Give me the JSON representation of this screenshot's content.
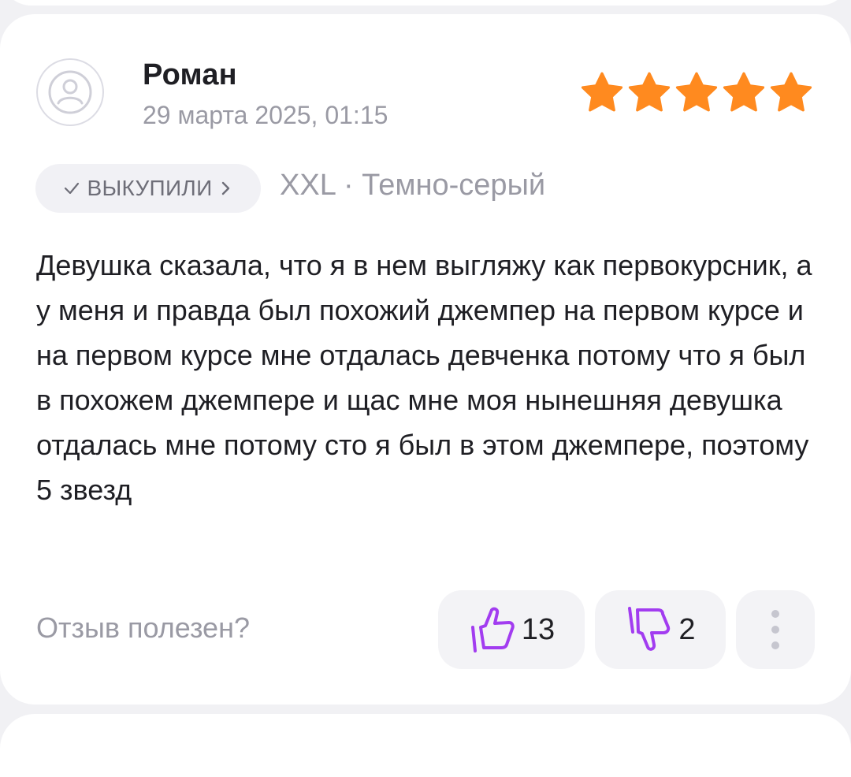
{
  "review": {
    "author": "Роман",
    "date": "29 марта 2025, 01:15",
    "rating": 5,
    "rating_max": 5,
    "purchased_badge": "ВЫКУПИЛИ",
    "variant": "XXL · Темно-серый",
    "text": "Девушка сказала, что я в нем выгляжу как первокурсник, а у меня и правда был похожий джемпер на первом курсе и на первом курсе мне отдалась девченка потому что я был в похожем джемпере и щас мне моя нынешняя девушка отдалась мне потому сто я был в этом джемпере, поэтому 5 звезд"
  },
  "footer": {
    "helpful_question": "Отзыв полезен?",
    "likes": "13",
    "dislikes": "2"
  },
  "icons": {
    "avatar": "user-avatar-icon",
    "star": "star-icon",
    "check": "check-icon",
    "chevron": "chevron-right-icon",
    "like": "thumbs-up-icon",
    "dislike": "thumbs-down-icon",
    "more": "more-vertical-icon"
  },
  "colors": {
    "star": "#ff8a1f",
    "thumb": "#a23cf0",
    "muted_text": "#9a9aa4",
    "text": "#1f1f24"
  }
}
